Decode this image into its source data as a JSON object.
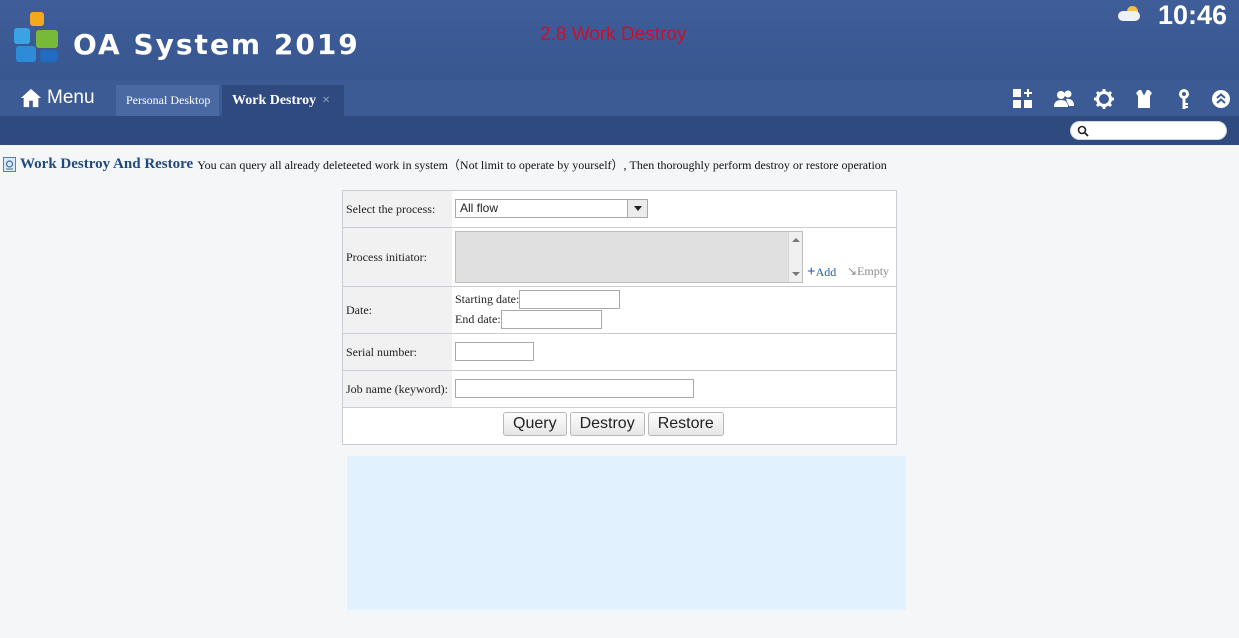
{
  "header": {
    "app_title": "OA System 2019",
    "page_heading": "2.8 Work Destroy",
    "clock": "10:46",
    "weather_icon": "partly-cloudy-icon"
  },
  "nav": {
    "menu_label": "Menu",
    "tabs": [
      {
        "label": "Personal Desktop",
        "active": false
      },
      {
        "label": "Work Destroy",
        "active": true,
        "close": "×"
      }
    ],
    "toolbar_icons": [
      "apps-add-icon",
      "users-icon",
      "gear-icon",
      "shirt-icon",
      "key-icon",
      "chevron-up-icon"
    ]
  },
  "search": {
    "placeholder": ""
  },
  "section": {
    "title": "Work Destroy And Restore",
    "description": "You can query all already deleteeted work in system（Not limit to operate by yourself）, Then thoroughly perform destroy or restore operation"
  },
  "form": {
    "process_label": "Select the process:",
    "process_value": "All flow",
    "initiator_label": "Process initiator:",
    "add_label": "Add",
    "empty_label": "Empty",
    "date_label": "Date:",
    "start_date_label": "Starting date:",
    "end_date_label": "End date:",
    "serial_label": "Serial number:",
    "jobname_label": "Job name (keyword):",
    "buttons": {
      "query": "Query",
      "destroy": "Destroy",
      "restore": "Restore"
    }
  },
  "colors": {
    "header_bg": "#3c5a94",
    "subbar_bg": "#2e4a7e",
    "heading_red": "#c8102e",
    "title_blue": "#1f4a7d",
    "result_bg": "#e1f1fd"
  }
}
